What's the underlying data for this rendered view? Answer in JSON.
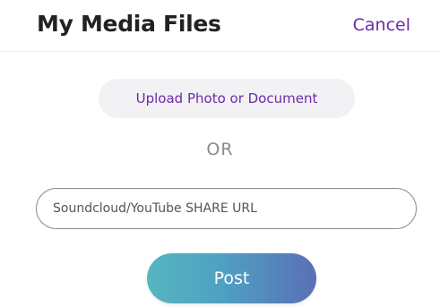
{
  "header": {
    "title": "My Media Files",
    "cancel_label": "Cancel"
  },
  "upload": {
    "label": "Upload Photo or Document"
  },
  "divider": {
    "label": "OR"
  },
  "url_field": {
    "value": "",
    "placeholder": "Soundcloud/YouTube SHARE URL"
  },
  "post": {
    "label": "Post"
  },
  "colors": {
    "accent": "#6f2aa8",
    "title": "#222222",
    "upload_background": "#f2f1f4",
    "post_gradient_start": "#55b6c0",
    "post_gradient_end": "#5a6fb6"
  }
}
